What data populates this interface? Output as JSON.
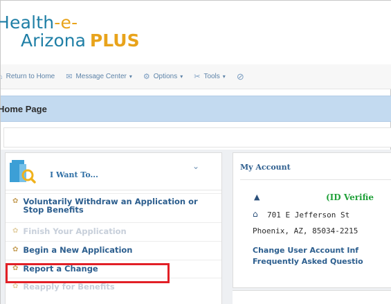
{
  "logo": {
    "line1_main": "Health",
    "line1_accent": "-e-",
    "line2_main": "Arizona",
    "line2_accent": "PLUS"
  },
  "toolbar": {
    "items": [
      {
        "label": "Return to Home",
        "icon": "house-icon",
        "dropdown": false
      },
      {
        "label": "Message Center",
        "icon": "message-icon",
        "dropdown": true
      },
      {
        "label": "Options",
        "icon": "gear-icon",
        "dropdown": true
      },
      {
        "label": "Tools",
        "icon": "tools-icon",
        "dropdown": true
      }
    ],
    "trailing_icon": "clock-icon"
  },
  "page": {
    "title": "Home Page"
  },
  "want_to": {
    "title": "I Want To...",
    "items": [
      {
        "label": "Voluntarily Withdraw an Application or Stop Benefits",
        "enabled": true
      },
      {
        "label": "Finish Your Application",
        "enabled": false
      },
      {
        "label": "Begin a New Application",
        "enabled": true
      },
      {
        "label": "Report a Change",
        "enabled": true,
        "highlighted": true
      },
      {
        "label": "Reapply for Benefits",
        "enabled": false
      }
    ]
  },
  "account": {
    "title": "My Account",
    "id_status": "(ID Verifie",
    "address_line1": "701 E Jefferson St",
    "address_line2": "Phoenix, AZ, 85034-2215",
    "links": [
      "Change User Account Inf",
      "Frequently Asked Questio"
    ]
  },
  "colors": {
    "brand_blue": "#1f7fa6",
    "brand_orange": "#e8a31b",
    "header_band": "#c3daf0",
    "link": "#2c5e8e",
    "verified_green": "#21a13a",
    "highlight_red": "#e21f26"
  }
}
